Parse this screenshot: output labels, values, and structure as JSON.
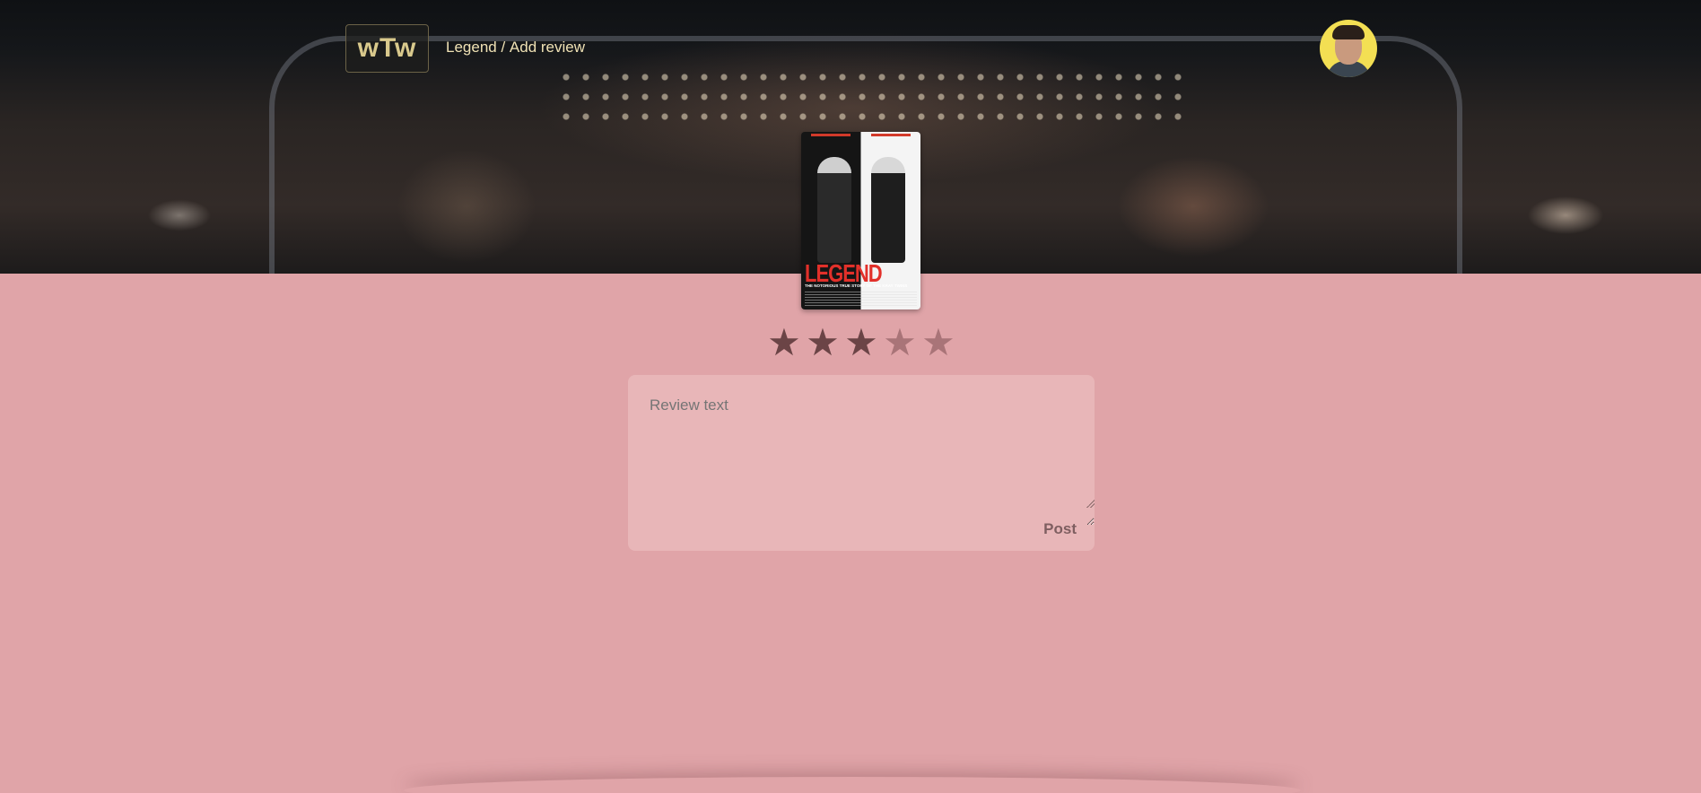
{
  "header": {
    "logo_text": "wTw",
    "breadcrumb": {
      "movie": "Legend",
      "separator": " / ",
      "page": "Add review"
    }
  },
  "poster": {
    "title": "LEGEND",
    "tagline": "THE NOTORIOUS TRUE STORY OF THE KRAY TWINS"
  },
  "rating": {
    "value": 3,
    "max": 5,
    "star_glyph": "★"
  },
  "review": {
    "placeholder": "Review text",
    "value": "",
    "post_label": "Post"
  },
  "colors": {
    "page_background": "#e0a4a8",
    "card_background": "#e8b6b8",
    "star_on": "#6b4446",
    "star_off": "#a97478",
    "logo_accent": "#d9c98c"
  },
  "icons": {
    "rating": "star-icon",
    "user": "avatar"
  }
}
